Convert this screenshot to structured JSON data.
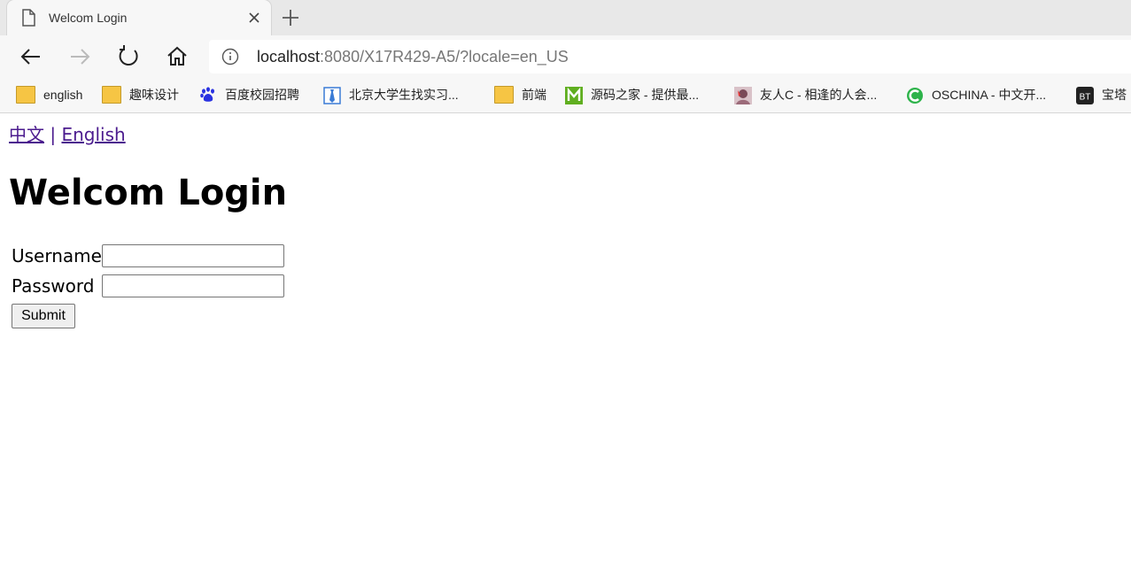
{
  "browser": {
    "tab_title": "Welcom Login",
    "url_host": "localhost",
    "url_rest": ":8080/X17R429-A5/?locale=en_US"
  },
  "bookmarks": [
    {
      "label": "english",
      "icon": "folder-icon"
    },
    {
      "label": "趣味设计",
      "icon": "folder-icon"
    },
    {
      "label": "百度校园招聘",
      "icon": "baidu-paw-icon"
    },
    {
      "label": "北京大学生找实习...",
      "icon": "tie-icon"
    },
    {
      "label": "前端",
      "icon": "folder-icon"
    },
    {
      "label": "源码之家 - 提供最...",
      "icon": "m-logo-icon"
    },
    {
      "label": "友人C - 相逢的人会...",
      "icon": "avatar-icon"
    },
    {
      "label": "OSCHINA - 中文开...",
      "icon": "oschina-logo-icon"
    },
    {
      "label": "宝塔",
      "icon": "bt-logo-icon"
    }
  ],
  "page": {
    "lang_zh": "中文",
    "lang_sep": "|",
    "lang_en": "English",
    "heading": "Welcom Login",
    "username_label": "Username",
    "password_label": "Password",
    "submit_label": "Submit"
  },
  "colors": {
    "link": "#4b1b8e",
    "tabstrip_bg": "#e8e8e8",
    "toolbar_bg": "#f7f7f7"
  }
}
